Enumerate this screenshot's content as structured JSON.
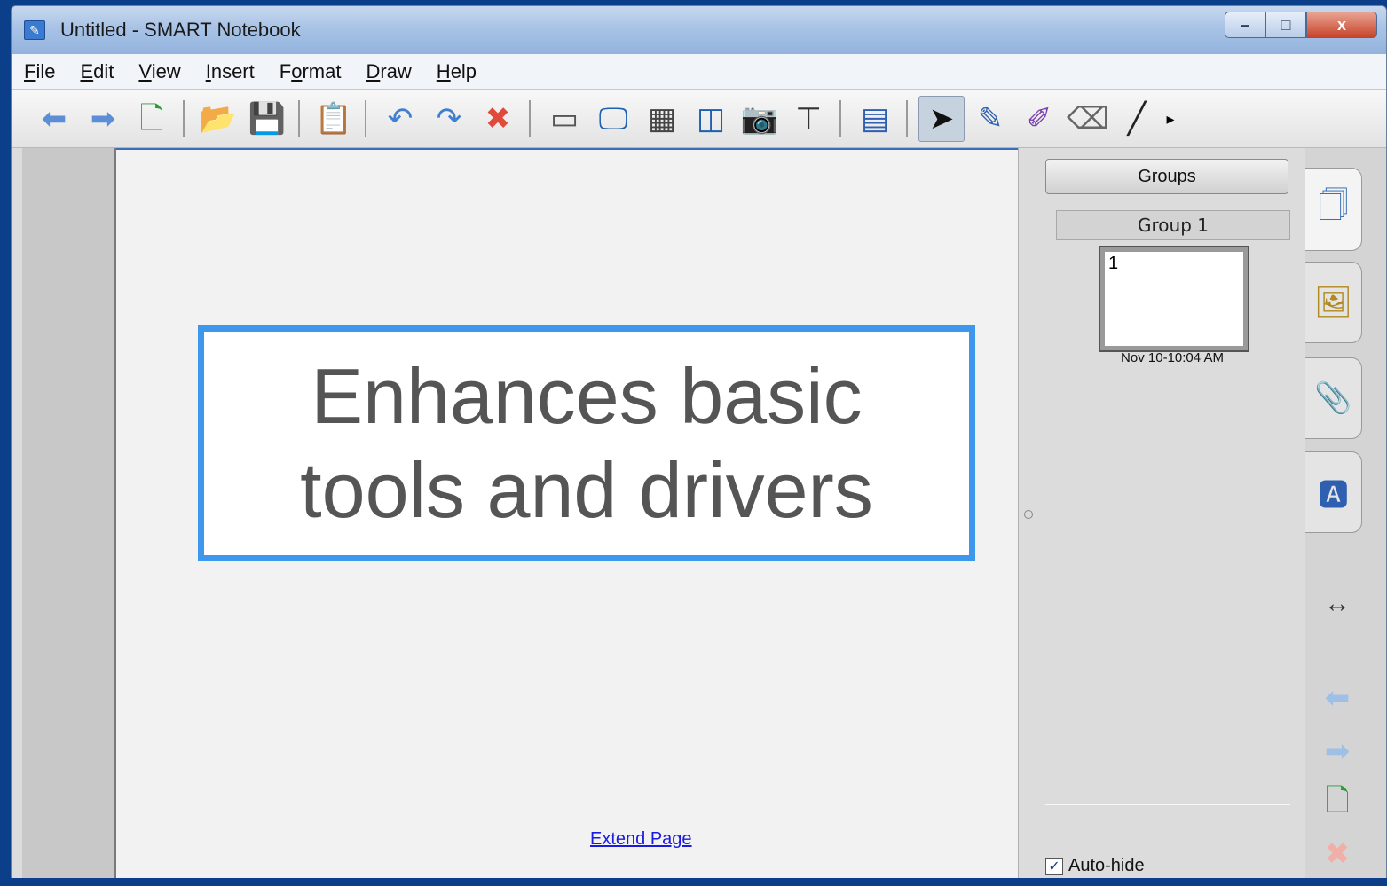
{
  "window": {
    "title": "Untitled - SMART Notebook",
    "controls": {
      "minimize": "–",
      "maximize": "□",
      "close": "x"
    }
  },
  "menu": [
    {
      "label": "File",
      "key": "F",
      "rest": "ile"
    },
    {
      "label": "Edit",
      "key": "E",
      "rest": "dit"
    },
    {
      "label": "View",
      "key": "V",
      "rest": "iew"
    },
    {
      "label": "Insert",
      "key": "I",
      "rest": "nsert"
    },
    {
      "label": "Format",
      "pre": "F",
      "key": "o",
      "rest": "rmat"
    },
    {
      "label": "Draw",
      "key": "D",
      "rest": "raw"
    },
    {
      "label": "Help",
      "key": "H",
      "rest": "elp"
    }
  ],
  "toolbar": {
    "groups": [
      [
        {
          "name": "back-arrow-icon",
          "glyph": "⬅",
          "color": "#5b8ed6"
        },
        {
          "name": "forward-arrow-icon",
          "glyph": "➡",
          "color": "#5b8ed6"
        },
        {
          "name": "add-page-icon",
          "glyph": "🗋",
          "color": "#2f9a3a"
        }
      ],
      [
        {
          "name": "open-folder-icon",
          "glyph": "📂",
          "color": "#d9a520"
        },
        {
          "name": "save-icon",
          "glyph": "💾",
          "color": "#2f5fb0"
        }
      ],
      [
        {
          "name": "paste-icon",
          "glyph": "📋",
          "color": "#b07a20"
        }
      ],
      [
        {
          "name": "undo-icon",
          "glyph": "↶",
          "color": "#3f7fd0"
        },
        {
          "name": "redo-icon",
          "glyph": "↷",
          "color": "#3f7fd0"
        },
        {
          "name": "delete-icon",
          "glyph": "✖",
          "color": "#e04a3a"
        }
      ],
      [
        {
          "name": "screen-shade-icon",
          "glyph": "▭",
          "color": "#555555"
        },
        {
          "name": "full-screen-icon",
          "glyph": "🖵",
          "color": "#1d5fb0"
        },
        {
          "name": "transparent-background-icon",
          "glyph": "▦",
          "color": "#444444"
        },
        {
          "name": "dual-page-icon",
          "glyph": "◫",
          "color": "#1d5fb0"
        },
        {
          "name": "screen-capture-icon",
          "glyph": "📷",
          "color": "#555555"
        },
        {
          "name": "document-camera-icon",
          "glyph": "⊤",
          "color": "#333333"
        }
      ],
      [
        {
          "name": "table-icon",
          "glyph": "▤",
          "color": "#2f5fb0"
        }
      ],
      [
        {
          "name": "select-arrow-icon",
          "glyph": "➤",
          "color": "#111111",
          "active": true
        },
        {
          "name": "pen-icon",
          "glyph": "✎",
          "color": "#2f5fb0"
        },
        {
          "name": "creative-pen-icon",
          "glyph": "✐",
          "color": "#7a3fb0"
        },
        {
          "name": "eraser-icon",
          "glyph": "⌫",
          "color": "#666666"
        },
        {
          "name": "line-icon",
          "glyph": "╱",
          "color": "#222222"
        }
      ]
    ],
    "more_glyph": "▸"
  },
  "canvas": {
    "text_line_1": "Enhances basic",
    "text_line_2": "tools and drivers",
    "extend_link": "Extend Page"
  },
  "sidebar": {
    "groups_button": "Groups",
    "group_name": "Group 1",
    "page_number": "1",
    "page_timestamp": "Nov 10-10:04 AM",
    "autohide_label": "Auto-hide",
    "autohide_checked": "✓"
  },
  "tabs": [
    {
      "name": "page-sorter-icon",
      "glyph": "🗍",
      "color": "#1d5fb0"
    },
    {
      "name": "gallery-icon",
      "glyph": "🖼",
      "color": "#b08a20"
    },
    {
      "name": "attachments-icon",
      "glyph": "📎",
      "color": "#555555"
    },
    {
      "name": "properties-icon",
      "glyph": "🅰",
      "color": "#2f5fb0"
    }
  ],
  "side_controls": {
    "move_sidebar": "↔",
    "prev_page": "⬅",
    "next_page": "➡",
    "add_page": "🗋",
    "delete_page": "✖"
  }
}
